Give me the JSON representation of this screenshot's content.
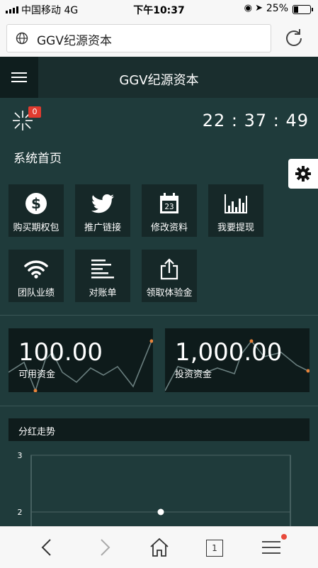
{
  "status_bar": {
    "carrier": "中国移动  4G",
    "time": "下午10:37",
    "battery": "25%"
  },
  "browser": {
    "address": "GGV纪源资本"
  },
  "header": {
    "title": "GGV纪源资本",
    "notification_count": "0",
    "clock": "22 : 37 : 49"
  },
  "page_title": "系统首页",
  "tiles": [
    {
      "label": "购买期权包",
      "icon": "dollar-icon"
    },
    {
      "label": "推广链接",
      "icon": "bird-icon"
    },
    {
      "label": "修改资料",
      "icon": "calendar-icon"
    },
    {
      "label": "我要提现",
      "icon": "bar-chart-icon"
    },
    {
      "label": "团队业绩",
      "icon": "wifi-icon"
    },
    {
      "label": "对账单",
      "icon": "list-icon"
    },
    {
      "label": "领取体验金",
      "icon": "share-icon"
    }
  ],
  "cards": [
    {
      "value": "100.00",
      "label": "可用资金"
    },
    {
      "value": "1,000.00",
      "label": "投资资金"
    }
  ],
  "chart_section_title": "分红走势",
  "chart_data": {
    "type": "line",
    "title": "分红走势",
    "yticks": [
      3,
      2
    ],
    "ylim": [
      1.5,
      3
    ],
    "points": [
      {
        "x": 0.5,
        "y": 2
      }
    ],
    "grid": true
  },
  "colors": {
    "page_bg": "#1f3b3b",
    "header_bg": "#1a2e2e",
    "tile_bg": "#162828",
    "badge": "#e03b2f",
    "sparkline_dot": "#e8833a"
  }
}
